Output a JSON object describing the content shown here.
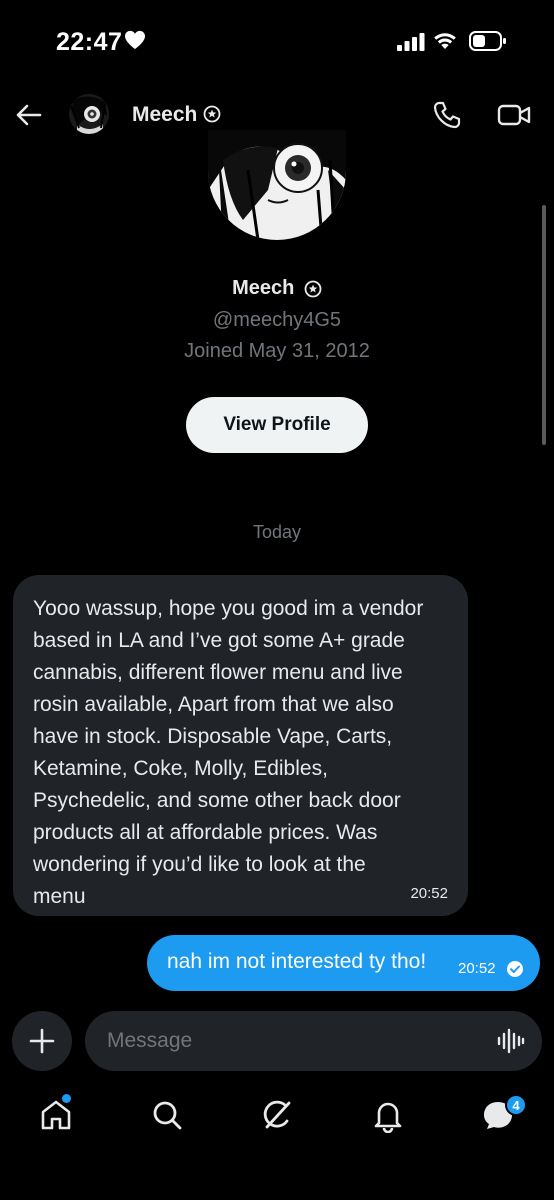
{
  "status_bar": {
    "time": "22:47"
  },
  "header": {
    "name": "Meech"
  },
  "profile": {
    "name": "Meech",
    "handle": "@meechy4G5",
    "joined": "Joined May 31, 2012",
    "view_profile_label": "View Profile"
  },
  "conversation": {
    "date_separator": "Today",
    "messages": [
      {
        "direction": "incoming",
        "text": "Yooo wassup, hope you good im a vendor\nbased in LA and I’ve got some A+ grade\ncannabis, different flower menu and live\nrosin available, Apart from that we also\nhave in stock. Disposable Vape,  Carts,\nKetamine, Coke, Molly, Edibles,\nPsychedelic, and some other back door\nproducts all at affordable prices. Was\nwondering if you’d like to look at the\nmenu",
        "time": "20:52"
      },
      {
        "direction": "outgoing",
        "text": "nah im not interested ty tho!",
        "time": "20:52"
      }
    ]
  },
  "composer": {
    "placeholder": "Message"
  },
  "bottom_nav": {
    "messages_badge": "4"
  },
  "colors": {
    "accent": "#1d9bf0",
    "incoming_bubble": "#202327",
    "background": "#000000"
  }
}
